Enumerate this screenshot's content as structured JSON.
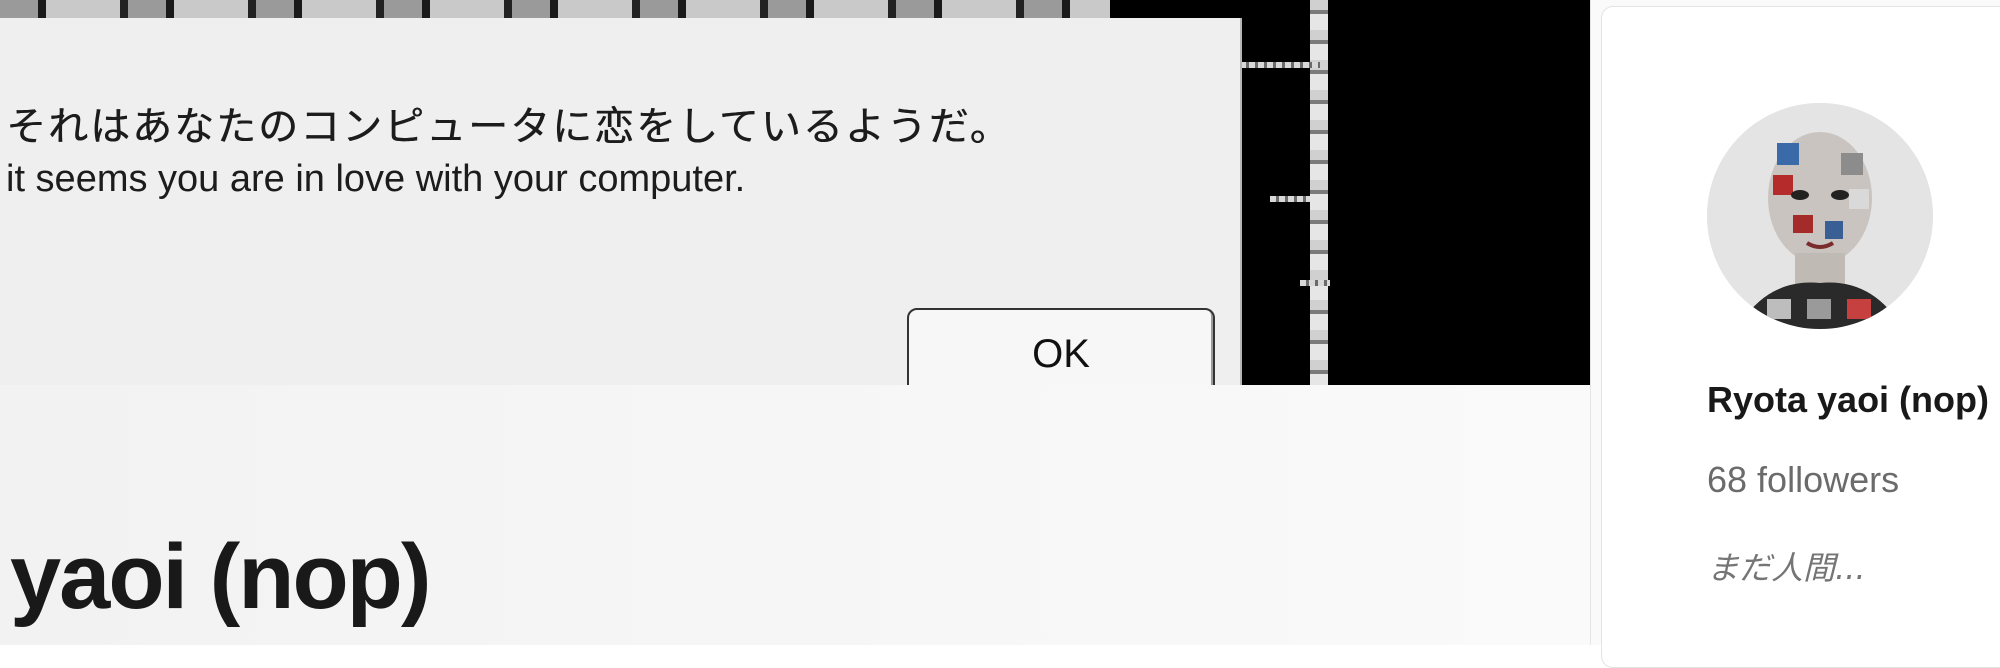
{
  "banner": {
    "dialog": {
      "message_jp": "それはあなたのコンピュータに恋をしているようだ。",
      "message_en": "it seems you are in love with your computer.",
      "ok_label": "OK"
    }
  },
  "profile": {
    "name": "yaoi (nop)"
  },
  "sidebar": {
    "author_name": "Ryota yaoi (nop)",
    "followers": "68 followers",
    "bio": "まだ人間..."
  },
  "colors": {
    "dialog_bg": "#efefef",
    "text_primary": "#191919",
    "text_secondary": "#6b6b6b"
  }
}
